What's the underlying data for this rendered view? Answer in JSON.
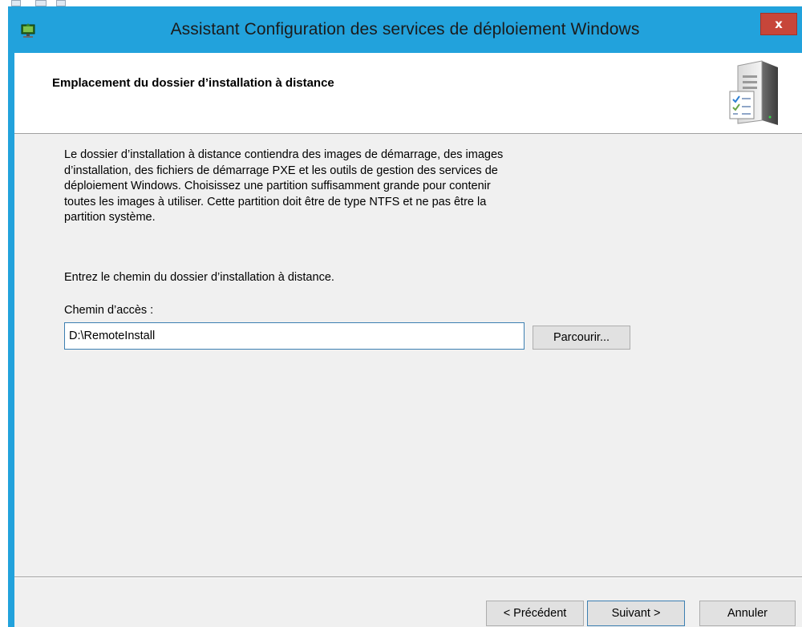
{
  "window": {
    "title": "Assistant Configuration des services de déploiement Windows",
    "close_label": "x"
  },
  "header": {
    "title": "Emplacement du dossier d’installation à distance"
  },
  "content": {
    "description": "Le dossier d’installation à distance contiendra des images de démarrage, des images\nd’installation, des fichiers de démarrage PXE et les outils de gestion des services de\ndéploiement Windows.  Choisissez une partition suffisamment grande pour contenir\ntoutes les images à utiliser. Cette partition doit être de type NTFS et ne pas être la\npartition système.",
    "prompt": "Entrez le chemin du dossier d’installation à distance.",
    "path_label": "Chemin d’accès :",
    "path_value": "D:\\RemoteInstall",
    "browse_label": "Parcourir..."
  },
  "footer": {
    "prev_label": "< Précédent",
    "next_label": "Suivant >",
    "cancel_label": "Annuler"
  },
  "colors": {
    "titlebar": "#22a2dc",
    "close": "#c7463a",
    "client": "#f0f0f0",
    "focus_border": "#3c7fb1"
  },
  "icons": {
    "app": "wds-setup-icon",
    "header": "server-checklist-icon",
    "close": "close-icon"
  }
}
